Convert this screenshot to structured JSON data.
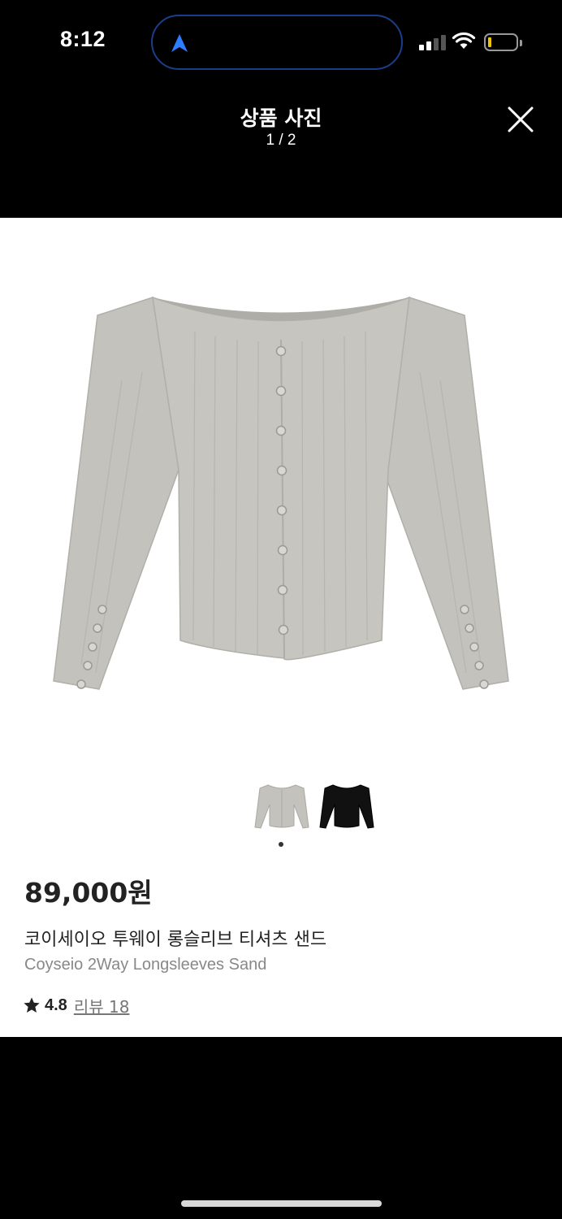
{
  "status_bar": {
    "time": "8:12",
    "island_icon": "navigation-arrow-icon",
    "island_icon_color": "#2f7dff",
    "battery_color": "#f2c200"
  },
  "header": {
    "title": "상품 사진",
    "page_indicator": "1 / 2",
    "close_icon": "close-icon"
  },
  "product": {
    "color_swatches": [
      {
        "name": "sand",
        "color": "#bdbcb6"
      },
      {
        "name": "black",
        "color": "#111111"
      }
    ],
    "price": "89,000원",
    "name_ko": "코이세이오 투웨이 롱슬리브 티셔츠 샌드",
    "name_en": "Coyseio 2Way Longsleeves Sand",
    "rating": "4.8",
    "review_label": "리뷰 18"
  }
}
